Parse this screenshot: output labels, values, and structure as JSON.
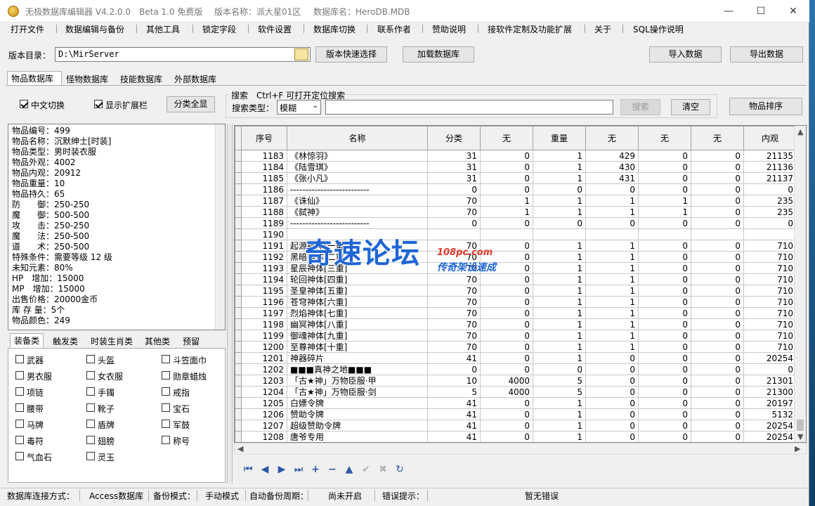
{
  "titlebar": {
    "app_name": "无极数据库编辑器 V4.2.0.0",
    "edition": "Beta 1.0 免费版",
    "version_name": "版本名称：派大星01区",
    "db_name": "数据库名：HeroDB.MDB",
    "minimize": "—",
    "maximize": "☐",
    "close": "✕"
  },
  "menu": [
    "打开文件",
    "数据编辑与备份",
    "其他工具",
    "锁定字段",
    "软件设置",
    "数据库切换",
    "联系作者",
    "赞助说明",
    "接软件定制及功能扩展",
    "关于",
    "SQL操作说明"
  ],
  "toolbar": {
    "dir_label": "版本目录：",
    "dir_value": "D:\\MirServer",
    "quick_select": "版本快速选择",
    "load_db": "加载数据库",
    "import": "导入数据",
    "export": "导出数据"
  },
  "db_tabs": [
    "物品数据库",
    "怪物数据库",
    "技能数据库",
    "外部数据库"
  ],
  "options": {
    "cn_switch": "中文切换",
    "show_ext": "显示扩展栏",
    "show_all": "分类全显"
  },
  "search": {
    "group_title": "搜索　Ctrl+F 可打开定位搜索",
    "type_label": "搜索类型：",
    "type_value": "模糊",
    "search_button": "搜索",
    "clear_button": "清空",
    "sort_button": "物品排序"
  },
  "item_info": [
    "物品编号：499",
    "物品名称：沉默绅士[时装]",
    "物品类型：男时装衣服",
    "物品外观：4002",
    "物品内观：20912",
    "物品重量：10",
    "物品持久：65",
    "防　　御：250-250",
    "魔　　御：500-500",
    "攻　　击：250-250",
    "魔　　法：250-500",
    "道　　术：250-500",
    "特殊条件：需要等级 12 级",
    "未知元素：80%",
    "HP　增加：15000",
    "MP　增加：15000",
    "出售价格：20000金币",
    "库 存 量：5个",
    "物品颜色：249"
  ],
  "category_tabs": [
    "装备类",
    "触发类",
    "时装生肖类",
    "其他类",
    "预留"
  ],
  "category_items": [
    [
      "武器",
      "头盔",
      "斗笠面巾"
    ],
    [
      "男衣服",
      "女衣服",
      "勋章蜡烛"
    ],
    [
      "项链",
      "手镯",
      "戒指"
    ],
    [
      "腰带",
      "靴子",
      "宝石"
    ],
    [
      "马牌",
      "盾牌",
      "军鼓"
    ],
    [
      "毒符",
      "翅膀",
      "称号"
    ],
    [
      "气血石",
      "灵玉",
      ""
    ]
  ],
  "grid": {
    "columns": [
      "序号",
      "名称",
      "分类",
      "无",
      "重量",
      "无",
      "无",
      "无",
      "内观"
    ],
    "rows": [
      [
        "1183",
        "《林惊羽》",
        "31",
        "0",
        "1",
        "429",
        "0",
        "0",
        "21135"
      ],
      [
        "1184",
        "《陆雪琪》",
        "31",
        "0",
        "1",
        "430",
        "0",
        "0",
        "21136"
      ],
      [
        "1185",
        "《张小凡》",
        "31",
        "0",
        "1",
        "431",
        "0",
        "0",
        "21137"
      ],
      [
        "1186",
        "--------------------------",
        "0",
        "0",
        "0",
        "0",
        "0",
        "0",
        "0"
      ],
      [
        "1187",
        "《诛仙》",
        "70",
        "1",
        "1",
        "1",
        "1",
        "0",
        "235"
      ],
      [
        "1188",
        "《弑神》",
        "70",
        "1",
        "1",
        "1",
        "1",
        "0",
        "235"
      ],
      [
        "1189",
        "--------------------------",
        "0",
        "0",
        "0",
        "0",
        "0",
        "0",
        "0"
      ],
      [
        "1190",
        "",
        "",
        "",
        "",
        "",
        "",
        "",
        ""
      ],
      [
        "1191",
        "起源神体[一重]",
        "70",
        "0",
        "1",
        "1",
        "0",
        "0",
        "710"
      ],
      [
        "1192",
        "黑暗神体[二重]",
        "70",
        "0",
        "1",
        "1",
        "0",
        "0",
        "710"
      ],
      [
        "1193",
        "星辰神体[三重]",
        "70",
        "0",
        "1",
        "1",
        "0",
        "0",
        "710"
      ],
      [
        "1194",
        "轮回神体[四重]",
        "70",
        "0",
        "1",
        "1",
        "0",
        "0",
        "710"
      ],
      [
        "1195",
        "圣皇神体[五重]",
        "70",
        "0",
        "1",
        "1",
        "0",
        "0",
        "710"
      ],
      [
        "1196",
        "苍穹神体[六重]",
        "70",
        "0",
        "1",
        "1",
        "0",
        "0",
        "710"
      ],
      [
        "1197",
        "烈焰神体[七重]",
        "70",
        "0",
        "1",
        "1",
        "0",
        "0",
        "710"
      ],
      [
        "1198",
        "幽冥神体[八重]",
        "70",
        "0",
        "1",
        "1",
        "0",
        "0",
        "710"
      ],
      [
        "1199",
        "御魂神体[九重]",
        "70",
        "0",
        "1",
        "1",
        "0",
        "0",
        "710"
      ],
      [
        "1200",
        "至尊神体[十重]",
        "70",
        "0",
        "1",
        "1",
        "0",
        "0",
        "710"
      ],
      [
        "1201",
        "神器碎片",
        "41",
        "0",
        "1",
        "0",
        "0",
        "0",
        "20254"
      ],
      [
        "1202",
        "■■■真神之地■■■",
        "0",
        "0",
        "0",
        "0",
        "0",
        "0",
        "0"
      ],
      [
        "1203",
        "「古★神」万物臣服·甲",
        "10",
        "4000",
        "5",
        "0",
        "0",
        "0",
        "21301"
      ],
      [
        "1204",
        "「古★神」万物臣服·剑",
        "5",
        "4000",
        "5",
        "0",
        "0",
        "0",
        "21300"
      ],
      [
        "1205",
        "白嫖令牌",
        "41",
        "0",
        "1",
        "0",
        "0",
        "0",
        "20197"
      ],
      [
        "1206",
        "赞助令牌",
        "41",
        "0",
        "1",
        "0",
        "0",
        "0",
        "5132"
      ],
      [
        "1207",
        "超级赞助令牌",
        "41",
        "0",
        "1",
        "0",
        "0",
        "0",
        "20254"
      ],
      [
        "1208",
        "唐爷专用",
        "41",
        "0",
        "1",
        "0",
        "0",
        "0",
        "20254"
      ]
    ]
  },
  "navigator": [
    "first-icon",
    "prior-icon",
    "next-icon",
    "last-icon",
    "insert-icon",
    "delete-icon",
    "edit-icon",
    "post-icon",
    "cancel-icon",
    "refresh-icon"
  ],
  "watermark": {
    "big": "奇速论坛",
    "url": "108pc.com",
    "sub": "传奇架设速成"
  },
  "status": {
    "conn_label": "数据库连接方式：",
    "conn_value": "Access数据库",
    "backup_label": "备份模式：",
    "backup_value": "手动模式",
    "auto_label": "自动备份周期：",
    "auto_value": "尚未开启",
    "err_label": "错误提示：",
    "err_value": "暂无错误"
  }
}
